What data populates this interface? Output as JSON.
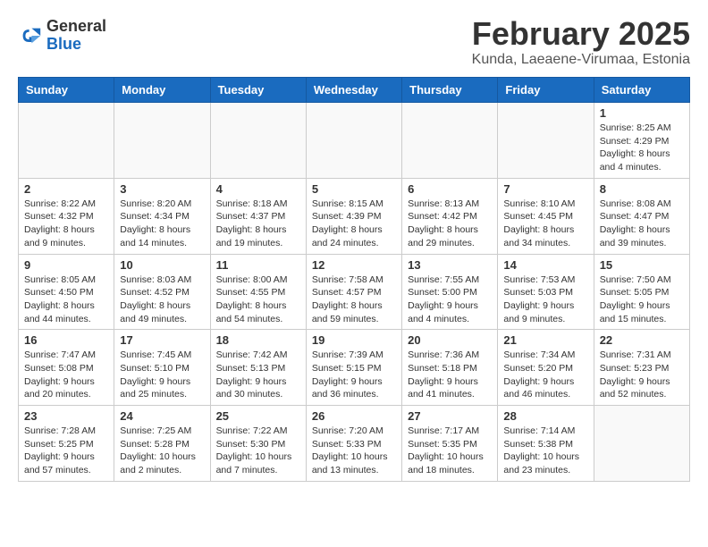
{
  "header": {
    "logo_general": "General",
    "logo_blue": "Blue",
    "month_year": "February 2025",
    "location": "Kunda, Laeaene-Virumaa, Estonia"
  },
  "weekdays": [
    "Sunday",
    "Monday",
    "Tuesday",
    "Wednesday",
    "Thursday",
    "Friday",
    "Saturday"
  ],
  "weeks": [
    [
      {
        "day": "",
        "info": ""
      },
      {
        "day": "",
        "info": ""
      },
      {
        "day": "",
        "info": ""
      },
      {
        "day": "",
        "info": ""
      },
      {
        "day": "",
        "info": ""
      },
      {
        "day": "",
        "info": ""
      },
      {
        "day": "1",
        "info": "Sunrise: 8:25 AM\nSunset: 4:29 PM\nDaylight: 8 hours and 4 minutes."
      }
    ],
    [
      {
        "day": "2",
        "info": "Sunrise: 8:22 AM\nSunset: 4:32 PM\nDaylight: 8 hours and 9 minutes."
      },
      {
        "day": "3",
        "info": "Sunrise: 8:20 AM\nSunset: 4:34 PM\nDaylight: 8 hours and 14 minutes."
      },
      {
        "day": "4",
        "info": "Sunrise: 8:18 AM\nSunset: 4:37 PM\nDaylight: 8 hours and 19 minutes."
      },
      {
        "day": "5",
        "info": "Sunrise: 8:15 AM\nSunset: 4:39 PM\nDaylight: 8 hours and 24 minutes."
      },
      {
        "day": "6",
        "info": "Sunrise: 8:13 AM\nSunset: 4:42 PM\nDaylight: 8 hours and 29 minutes."
      },
      {
        "day": "7",
        "info": "Sunrise: 8:10 AM\nSunset: 4:45 PM\nDaylight: 8 hours and 34 minutes."
      },
      {
        "day": "8",
        "info": "Sunrise: 8:08 AM\nSunset: 4:47 PM\nDaylight: 8 hours and 39 minutes."
      }
    ],
    [
      {
        "day": "9",
        "info": "Sunrise: 8:05 AM\nSunset: 4:50 PM\nDaylight: 8 hours and 44 minutes."
      },
      {
        "day": "10",
        "info": "Sunrise: 8:03 AM\nSunset: 4:52 PM\nDaylight: 8 hours and 49 minutes."
      },
      {
        "day": "11",
        "info": "Sunrise: 8:00 AM\nSunset: 4:55 PM\nDaylight: 8 hours and 54 minutes."
      },
      {
        "day": "12",
        "info": "Sunrise: 7:58 AM\nSunset: 4:57 PM\nDaylight: 8 hours and 59 minutes."
      },
      {
        "day": "13",
        "info": "Sunrise: 7:55 AM\nSunset: 5:00 PM\nDaylight: 9 hours and 4 minutes."
      },
      {
        "day": "14",
        "info": "Sunrise: 7:53 AM\nSunset: 5:03 PM\nDaylight: 9 hours and 9 minutes."
      },
      {
        "day": "15",
        "info": "Sunrise: 7:50 AM\nSunset: 5:05 PM\nDaylight: 9 hours and 15 minutes."
      }
    ],
    [
      {
        "day": "16",
        "info": "Sunrise: 7:47 AM\nSunset: 5:08 PM\nDaylight: 9 hours and 20 minutes."
      },
      {
        "day": "17",
        "info": "Sunrise: 7:45 AM\nSunset: 5:10 PM\nDaylight: 9 hours and 25 minutes."
      },
      {
        "day": "18",
        "info": "Sunrise: 7:42 AM\nSunset: 5:13 PM\nDaylight: 9 hours and 30 minutes."
      },
      {
        "day": "19",
        "info": "Sunrise: 7:39 AM\nSunset: 5:15 PM\nDaylight: 9 hours and 36 minutes."
      },
      {
        "day": "20",
        "info": "Sunrise: 7:36 AM\nSunset: 5:18 PM\nDaylight: 9 hours and 41 minutes."
      },
      {
        "day": "21",
        "info": "Sunrise: 7:34 AM\nSunset: 5:20 PM\nDaylight: 9 hours and 46 minutes."
      },
      {
        "day": "22",
        "info": "Sunrise: 7:31 AM\nSunset: 5:23 PM\nDaylight: 9 hours and 52 minutes."
      }
    ],
    [
      {
        "day": "23",
        "info": "Sunrise: 7:28 AM\nSunset: 5:25 PM\nDaylight: 9 hours and 57 minutes."
      },
      {
        "day": "24",
        "info": "Sunrise: 7:25 AM\nSunset: 5:28 PM\nDaylight: 10 hours and 2 minutes."
      },
      {
        "day": "25",
        "info": "Sunrise: 7:22 AM\nSunset: 5:30 PM\nDaylight: 10 hours and 7 minutes."
      },
      {
        "day": "26",
        "info": "Sunrise: 7:20 AM\nSunset: 5:33 PM\nDaylight: 10 hours and 13 minutes."
      },
      {
        "day": "27",
        "info": "Sunrise: 7:17 AM\nSunset: 5:35 PM\nDaylight: 10 hours and 18 minutes."
      },
      {
        "day": "28",
        "info": "Sunrise: 7:14 AM\nSunset: 5:38 PM\nDaylight: 10 hours and 23 minutes."
      },
      {
        "day": "",
        "info": ""
      }
    ]
  ]
}
